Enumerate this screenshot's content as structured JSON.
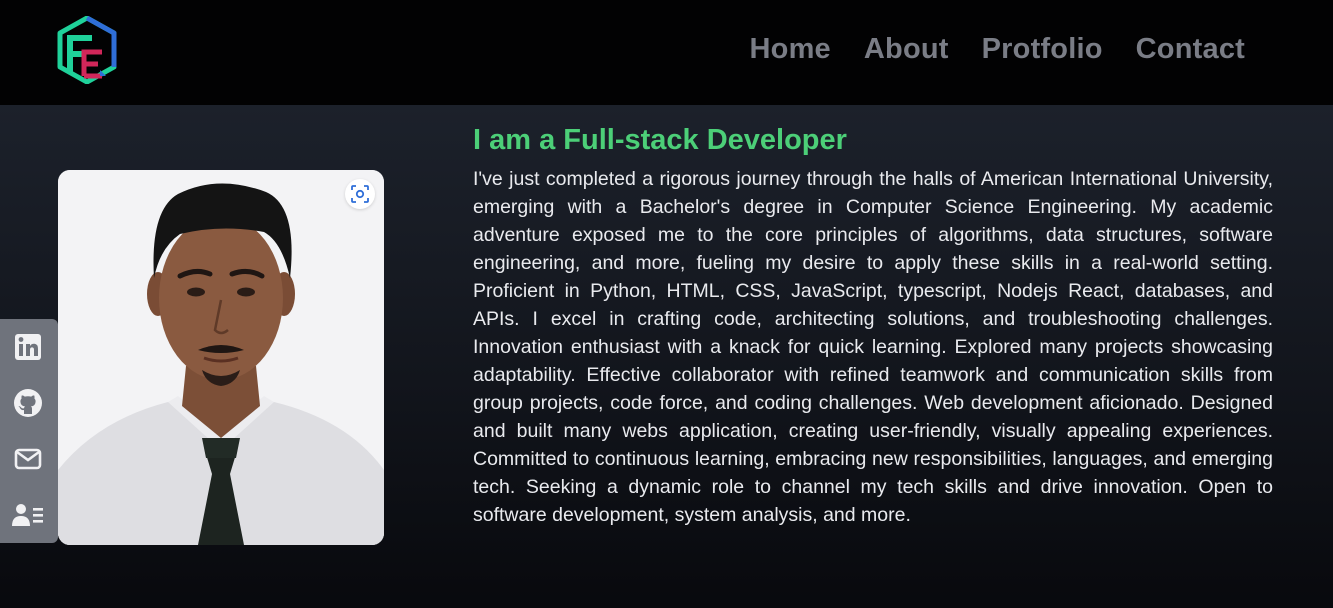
{
  "nav": {
    "links": [
      {
        "label": "Home"
      },
      {
        "label": "About"
      },
      {
        "label": "Protfolio"
      },
      {
        "label": "Contact"
      }
    ]
  },
  "logo": {
    "icon": "hexagon-logo-icon",
    "colors": [
      "#1fd19a",
      "#2f6ed8",
      "#d1275a"
    ]
  },
  "social": [
    {
      "icon": "linkedin-icon"
    },
    {
      "icon": "github-icon"
    },
    {
      "icon": "mail-icon"
    },
    {
      "icon": "contact-card-icon"
    }
  ],
  "photo": {
    "overlay_icon": "lens-scan-icon"
  },
  "hero": {
    "headline": "I am a Full-stack Developer",
    "bio": "I've just completed a rigorous journey through the halls of American International University, emerging with a Bachelor's degree in Computer Science Engineering. My academic adventure exposed me to the core principles of algorithms, data structures, software engineering, and more, fueling my desire to apply these skills in a real-world setting. Proficient in Python, HTML, CSS, JavaScript, typescript, Nodejs React, databases, and APIs. I excel in crafting code, architecting solutions, and troubleshooting challenges. Innovation enthusiast with a knack for quick learning. Explored many projects showcasing adaptability. Effective collaborator with refined teamwork and communication skills from group projects, code force, and coding challenges. Web development aficionado. Designed and built many webs application, creating user-friendly, visually appealing experiences. Committed to continuous learning, embracing new responsibilities, languages, and emerging tech. Seeking a dynamic role to channel my tech skills and drive innovation. Open to software development, system analysis, and more."
  },
  "colors": {
    "accent": "#4ccf78",
    "navbar": "#020203",
    "nav_text": "#7a7d86",
    "social_bar": "#6f737c"
  }
}
